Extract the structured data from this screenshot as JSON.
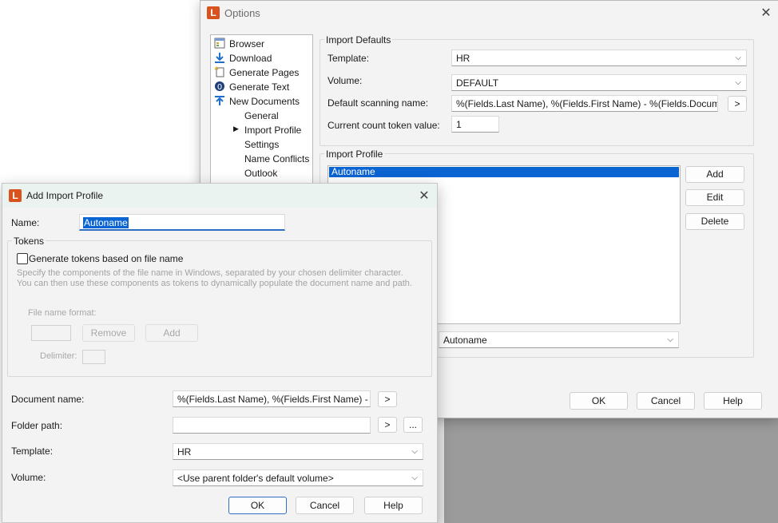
{
  "options": {
    "title": "Options",
    "tree": [
      {
        "label": "Browser",
        "icon": "browser-icon"
      },
      {
        "label": "Download",
        "icon": "download-icon"
      },
      {
        "label": "Generate Pages",
        "icon": "generate-pages-icon"
      },
      {
        "label": "Generate Text",
        "icon": "generate-text-icon"
      },
      {
        "label": "New Documents",
        "icon": "new-documents-icon"
      },
      {
        "label": "General"
      },
      {
        "label": "Import Profile"
      },
      {
        "label": "Settings"
      },
      {
        "label": "Name Conflicts"
      },
      {
        "label": "Outlook"
      }
    ],
    "import_defaults": {
      "group_label": "Import Defaults",
      "template_label": "Template:",
      "template_value": "HR",
      "volume_label": "Volume:",
      "volume_value": "DEFAULT",
      "scan_label": "Default scanning name:",
      "scan_value": "%(Fields.Last Name), %(Fields.First Name) - %(Fields.Document)",
      "scan_btn": ">",
      "count_label": "Current count token value:",
      "count_value": "1"
    },
    "import_profile": {
      "group_label": "Import Profile",
      "items": [
        "Autoname"
      ],
      "add": "Add",
      "edit": "Edit",
      "delete": "Delete",
      "default_value": "Autoname"
    },
    "ok": "OK",
    "cancel": "Cancel",
    "help": "Help"
  },
  "dialog": {
    "title": "Add Import Profile",
    "name_label": "Name:",
    "name_value": "Autoname",
    "tokens_group": "Tokens",
    "generate_label": "Generate tokens based on file name",
    "hint_line1": "Specify the components of the file name in Windows, separated by your chosen delimiter character.",
    "hint_line2": "You can then use these components as tokens to dynamically populate the document name and path.",
    "file_format_label": "File name format:",
    "remove": "Remove",
    "add": "Add",
    "delimiter_label": "Delimiter:",
    "docname_label": "Document name:",
    "docname_value": "%(Fields.Last Name), %(Fields.First Name) - %(F",
    "docname_btn": ">",
    "folder_label": "Folder path:",
    "folder_value": "",
    "folder_btn": ">",
    "folder_browse": "...",
    "template_label": "Template:",
    "template_value": "HR",
    "volume_label": "Volume:",
    "volume_value": "<Use parent folder's default volume>",
    "ok": "OK",
    "cancel": "Cancel",
    "help": "Help"
  },
  "colors": {
    "accent": "#0a64d2",
    "logo": "#d9531e"
  }
}
